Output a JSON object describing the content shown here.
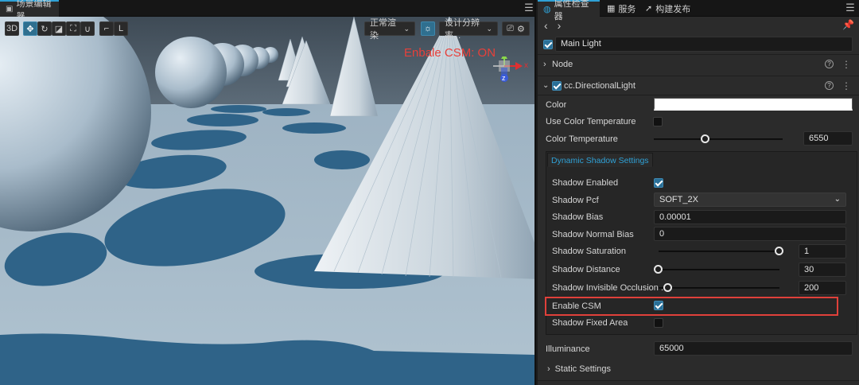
{
  "scene_panel": {
    "tab_title": "场景编辑器",
    "toolbar": {
      "mode_3d": "3D",
      "render_mode": "正常渲染",
      "resolution": "设计分辨率..."
    },
    "overlay_text": "Enbale CSM: ON",
    "gizmo": {
      "x_label": "x",
      "z_label": "z"
    }
  },
  "inspector": {
    "tabs": [
      {
        "label": "属性检查器"
      },
      {
        "label": "服务"
      },
      {
        "label": "构建发布"
      }
    ],
    "node_name": "Main Light",
    "node_section": "Node",
    "component_section": "cc.DirectionalLight",
    "props": {
      "color_label": "Color",
      "use_color_temperature_label": "Use Color Temperature",
      "color_temperature_label": "Color Temperature",
      "color_temperature_value": "6550",
      "color_temperature_fraction": 0.4
    },
    "dynamic_shadow": {
      "group_label": "Dynamic Shadow Settings",
      "shadow_enabled_label": "Shadow Enabled",
      "shadow_pcf_label": "Shadow Pcf",
      "shadow_pcf_value": "SOFT_2X",
      "shadow_bias_label": "Shadow Bias",
      "shadow_bias_value": "0.00001",
      "shadow_normal_bias_label": "Shadow Normal Bias",
      "shadow_normal_bias_value": "0",
      "shadow_saturation_label": "Shadow Saturation",
      "shadow_saturation_value": "1",
      "shadow_saturation_fraction": 1.0,
      "shadow_distance_label": "Shadow Distance",
      "shadow_distance_value": "30",
      "shadow_distance_fraction": 0.0,
      "shadow_invisible_label": "Shadow Invisible Occlusion ...",
      "shadow_invisible_value": "200",
      "shadow_invisible_fraction": 0.08,
      "enable_csm_label": "Enable CSM",
      "shadow_fixed_area_label": "Shadow Fixed Area"
    },
    "illuminance_label": "Illuminance",
    "illuminance_value": "65000",
    "static_settings_label": "Static Settings"
  },
  "colors": {
    "accent": "#2fa1d6",
    "highlight": "#e0403a",
    "floor": "#6f8ea5",
    "shadow": "#2f6388"
  }
}
